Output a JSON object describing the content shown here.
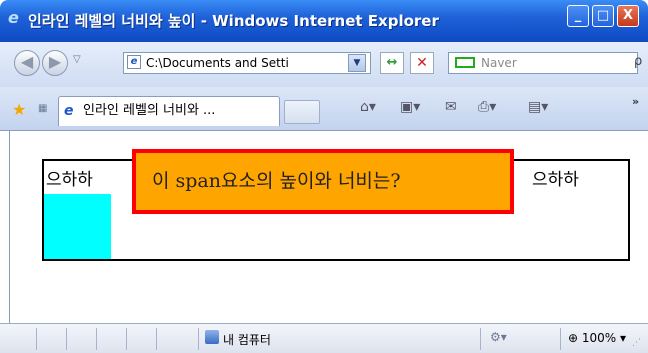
{
  "window": {
    "title": "인라인 레벨의 너비와 높이 - Windows Internet Explorer",
    "min_label": "_",
    "max_label": "□",
    "close_label": "X"
  },
  "addressbar": {
    "url": "C:\\Documents and Setti",
    "search_placeholder": "Naver",
    "back_glyph": "◀",
    "forward_glyph": "▶",
    "refresh_glyph": "↔",
    "stop_glyph": "✕"
  },
  "tabs": {
    "active_tab_label": "인라인 레벨의 너비와 ...",
    "more_glyph": "»"
  },
  "page": {
    "word_left": "으하하",
    "span_text": "이 span요소의 높이와 너비는?",
    "word_right": "으하하",
    "colors": {
      "span_background": "#ffa500",
      "span_border": "#ff0000",
      "block_background": "#00ffff"
    }
  },
  "statusbar": {
    "zone_label": "내 컴퓨터",
    "zoom_label": "100%"
  },
  "icons": [
    "ie-logo-icon",
    "back-icon",
    "forward-icon",
    "refresh-icon",
    "stop-icon",
    "naver-icon",
    "search-icon",
    "favorites-star-icon",
    "home-icon",
    "feeds-icon",
    "mail-icon",
    "print-icon",
    "page-icon",
    "computer-zone-icon",
    "zoom-icon"
  ]
}
